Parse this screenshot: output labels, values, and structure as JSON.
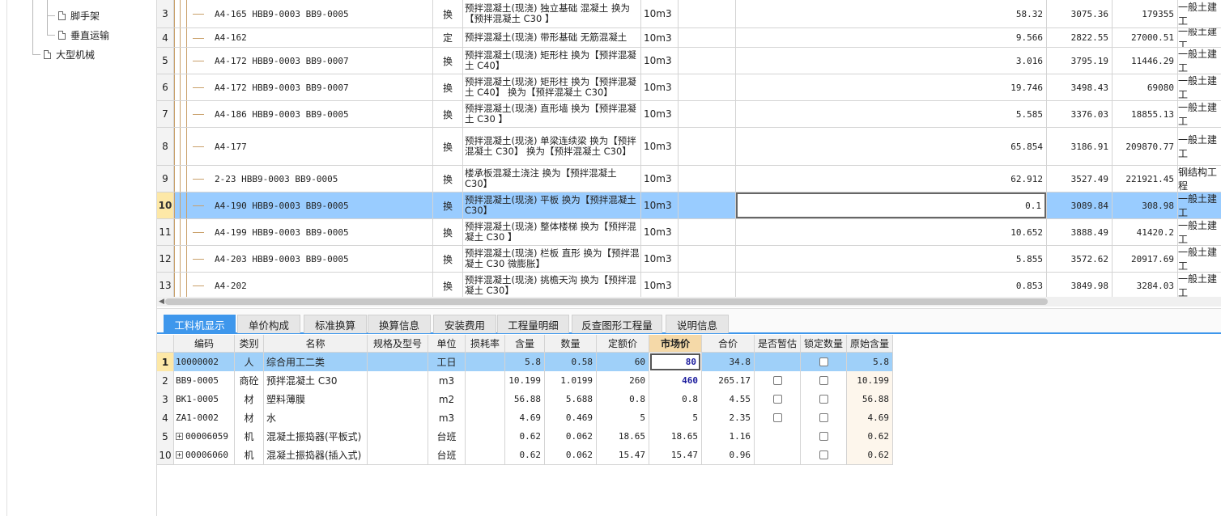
{
  "tree": {
    "items": [
      {
        "label": "脚手架",
        "icon": "document-icon"
      },
      {
        "label": "垂直运输",
        "icon": "document-icon"
      },
      {
        "label": "大型机械",
        "icon": "document-icon"
      }
    ]
  },
  "top_grid": {
    "rows": [
      {
        "idx": "3",
        "code": "A4-165 HBB9-0003 BB9-0005",
        "type": "换",
        "name": "预拌混凝土(现浇) 独立基础 混凝土  换为【预拌混凝土 C30 】",
        "unit": "10m3",
        "qty": "58.32",
        "price": "3075.36",
        "total": "179355",
        "spec": "一般土建工"
      },
      {
        "idx": "4",
        "code": "A4-162",
        "type": "定",
        "name": "预拌混凝土(现浇) 带形基础 无筋混凝土",
        "unit": "10m3",
        "qty": "9.566",
        "price": "2822.55",
        "total": "27000.51",
        "spec": "一般土建工"
      },
      {
        "idx": "5",
        "code": "A4-172 HBB9-0003 BB9-0007",
        "type": "换",
        "name": "预拌混凝土(现浇) 矩形柱  换为【预拌混凝土 C40】",
        "unit": "10m3",
        "qty": "3.016",
        "price": "3795.19",
        "total": "11446.29",
        "spec": "一般土建工"
      },
      {
        "idx": "6",
        "code": "A4-172 HBB9-0003 BB9-0007",
        "type": "换",
        "name": "预拌混凝土(现浇) 矩形柱  换为【预拌混凝土 C40】  换为【预拌混凝土 C30】",
        "unit": "10m3",
        "qty": "19.746",
        "price": "3498.43",
        "total": "69080",
        "spec": "一般土建工"
      },
      {
        "idx": "7",
        "code": "A4-186 HBB9-0003 BB9-0005",
        "type": "换",
        "name": "预拌混凝土(现浇) 直形墙  换为【预拌混凝土 C30 】",
        "unit": "10m3",
        "qty": "5.585",
        "price": "3376.03",
        "total": "18855.13",
        "spec": "一般土建工"
      },
      {
        "idx": "8",
        "code": "A4-177",
        "type": "换",
        "name": "预拌混凝土(现浇) 单梁连续梁  换为【预拌混凝土 C30】  换为【预拌混凝土 C30】",
        "unit": "10m3",
        "qty": "65.854",
        "price": "3186.91",
        "total": "209870.77",
        "spec": "一般土建工"
      },
      {
        "idx": "9",
        "code": "2-23 HBB9-0003 BB9-0005",
        "type": "换",
        "name": "楼承板混凝土浇注  换为【预拌混凝土 C30】",
        "unit": "10m3",
        "qty": "62.912",
        "price": "3527.49",
        "total": "221921.45",
        "spec": "钢结构工程"
      },
      {
        "idx": "10",
        "code": "A4-190 HBB9-0003 BB9-0005",
        "type": "换",
        "name": "预拌混凝土(现浇) 平板  换为【预拌混凝土 C30】",
        "unit": "10m3",
        "qty": "0.1",
        "price": "3089.84",
        "total": "308.98",
        "spec": "一般土建工",
        "selected": true
      },
      {
        "idx": "11",
        "code": "A4-199 HBB9-0003 BB9-0005",
        "type": "换",
        "name": "预拌混凝土(现浇) 整体楼梯  换为【预拌混凝土 C30 】",
        "unit": "10m3",
        "qty": "10.652",
        "price": "3888.49",
        "total": "41420.2",
        "spec": "一般土建工"
      },
      {
        "idx": "12",
        "code": "A4-203 HBB9-0003 BB9-0005",
        "type": "换",
        "name": "预拌混凝土(现浇) 栏板 直形  换为【预拌混凝土 C30 微膨胀】",
        "unit": "10m3",
        "qty": "5.855",
        "price": "3572.62",
        "total": "20917.69",
        "spec": "一般土建工"
      },
      {
        "idx": "13",
        "code": "A4-202",
        "type": "换",
        "name": "预拌混凝土(现浇) 挑檐天沟  换为【预拌混凝土 C30】",
        "unit": "10m3",
        "qty": "0.853",
        "price": "3849.98",
        "total": "3284.03",
        "spec": "一般土建工"
      }
    ]
  },
  "tabs": [
    {
      "label": "工料机显示",
      "active": true
    },
    {
      "label": "单价构成"
    },
    {
      "label": "标准换算"
    },
    {
      "label": "换算信息"
    },
    {
      "label": "安装费用"
    },
    {
      "label": "工程量明细"
    },
    {
      "label": "反查图形工程量"
    },
    {
      "label": "说明信息"
    }
  ],
  "bottom_grid": {
    "headers": [
      "编码",
      "类别",
      "名称",
      "规格及型号",
      "单位",
      "损耗率",
      "含量",
      "数量",
      "定额价",
      "市场价",
      "合价",
      "是否暂估",
      "锁定数量",
      "原始含量"
    ],
    "rows": [
      {
        "idx": "1",
        "code": "10000002",
        "cat": "人",
        "name": "综合用工二类",
        "spec": "",
        "unit": "工日",
        "loss": "",
        "content": "5.8",
        "qty": "0.58",
        "base": "60",
        "market": "80",
        "total": "34.8",
        "est": false,
        "est_shown": false,
        "lock": false,
        "orig": "5.8",
        "selected": true,
        "expand": false
      },
      {
        "idx": "2",
        "code": "BB9-0005",
        "cat": "商砼",
        "name": "预拌混凝土 C30",
        "spec": "",
        "unit": "m3",
        "loss": "",
        "content": "10.199",
        "qty": "1.0199",
        "base": "260",
        "market": "460",
        "total": "265.17",
        "est": false,
        "est_shown": true,
        "lock": false,
        "orig": "10.199",
        "market_bold": true,
        "expand": false
      },
      {
        "idx": "3",
        "code": "BK1-0005",
        "cat": "材",
        "name": "塑料薄膜",
        "spec": "",
        "unit": "m2",
        "loss": "",
        "content": "56.88",
        "qty": "5.688",
        "base": "0.8",
        "market": "0.8",
        "total": "4.55",
        "est": false,
        "est_shown": true,
        "lock": false,
        "orig": "56.88",
        "expand": false
      },
      {
        "idx": "4",
        "code": "ZA1-0002",
        "cat": "材",
        "name": "水",
        "spec": "",
        "unit": "m3",
        "loss": "",
        "content": "4.69",
        "qty": "0.469",
        "base": "5",
        "market": "5",
        "total": "2.35",
        "est": false,
        "est_shown": true,
        "lock": false,
        "orig": "4.69",
        "expand": false
      },
      {
        "idx": "5",
        "code": "00006059",
        "cat": "机",
        "name": "混凝土振捣器(平板式)",
        "spec": "",
        "unit": "台班",
        "loss": "",
        "content": "0.62",
        "qty": "0.062",
        "base": "18.65",
        "market": "18.65",
        "total": "1.16",
        "est": false,
        "est_shown": false,
        "lock": false,
        "orig": "0.62",
        "expand": true
      },
      {
        "idx": "10",
        "code": "00006060",
        "cat": "机",
        "name": "混凝土振捣器(插入式)",
        "spec": "",
        "unit": "台班",
        "loss": "",
        "content": "0.62",
        "qty": "0.062",
        "base": "15.47",
        "market": "15.47",
        "total": "0.96",
        "est": false,
        "est_shown": false,
        "lock": false,
        "orig": "0.62",
        "expand": true
      }
    ]
  },
  "icons": {
    "expand": "plus-icon",
    "checkbox": "checkbox-icon",
    "scroll_left": "scroll-left-arrow-icon"
  },
  "colors": {
    "selection": "#99ccff",
    "tab_active": "#3e97ec",
    "row_index_selected": "#fde8a7",
    "market_value": "#1a1a9c"
  }
}
